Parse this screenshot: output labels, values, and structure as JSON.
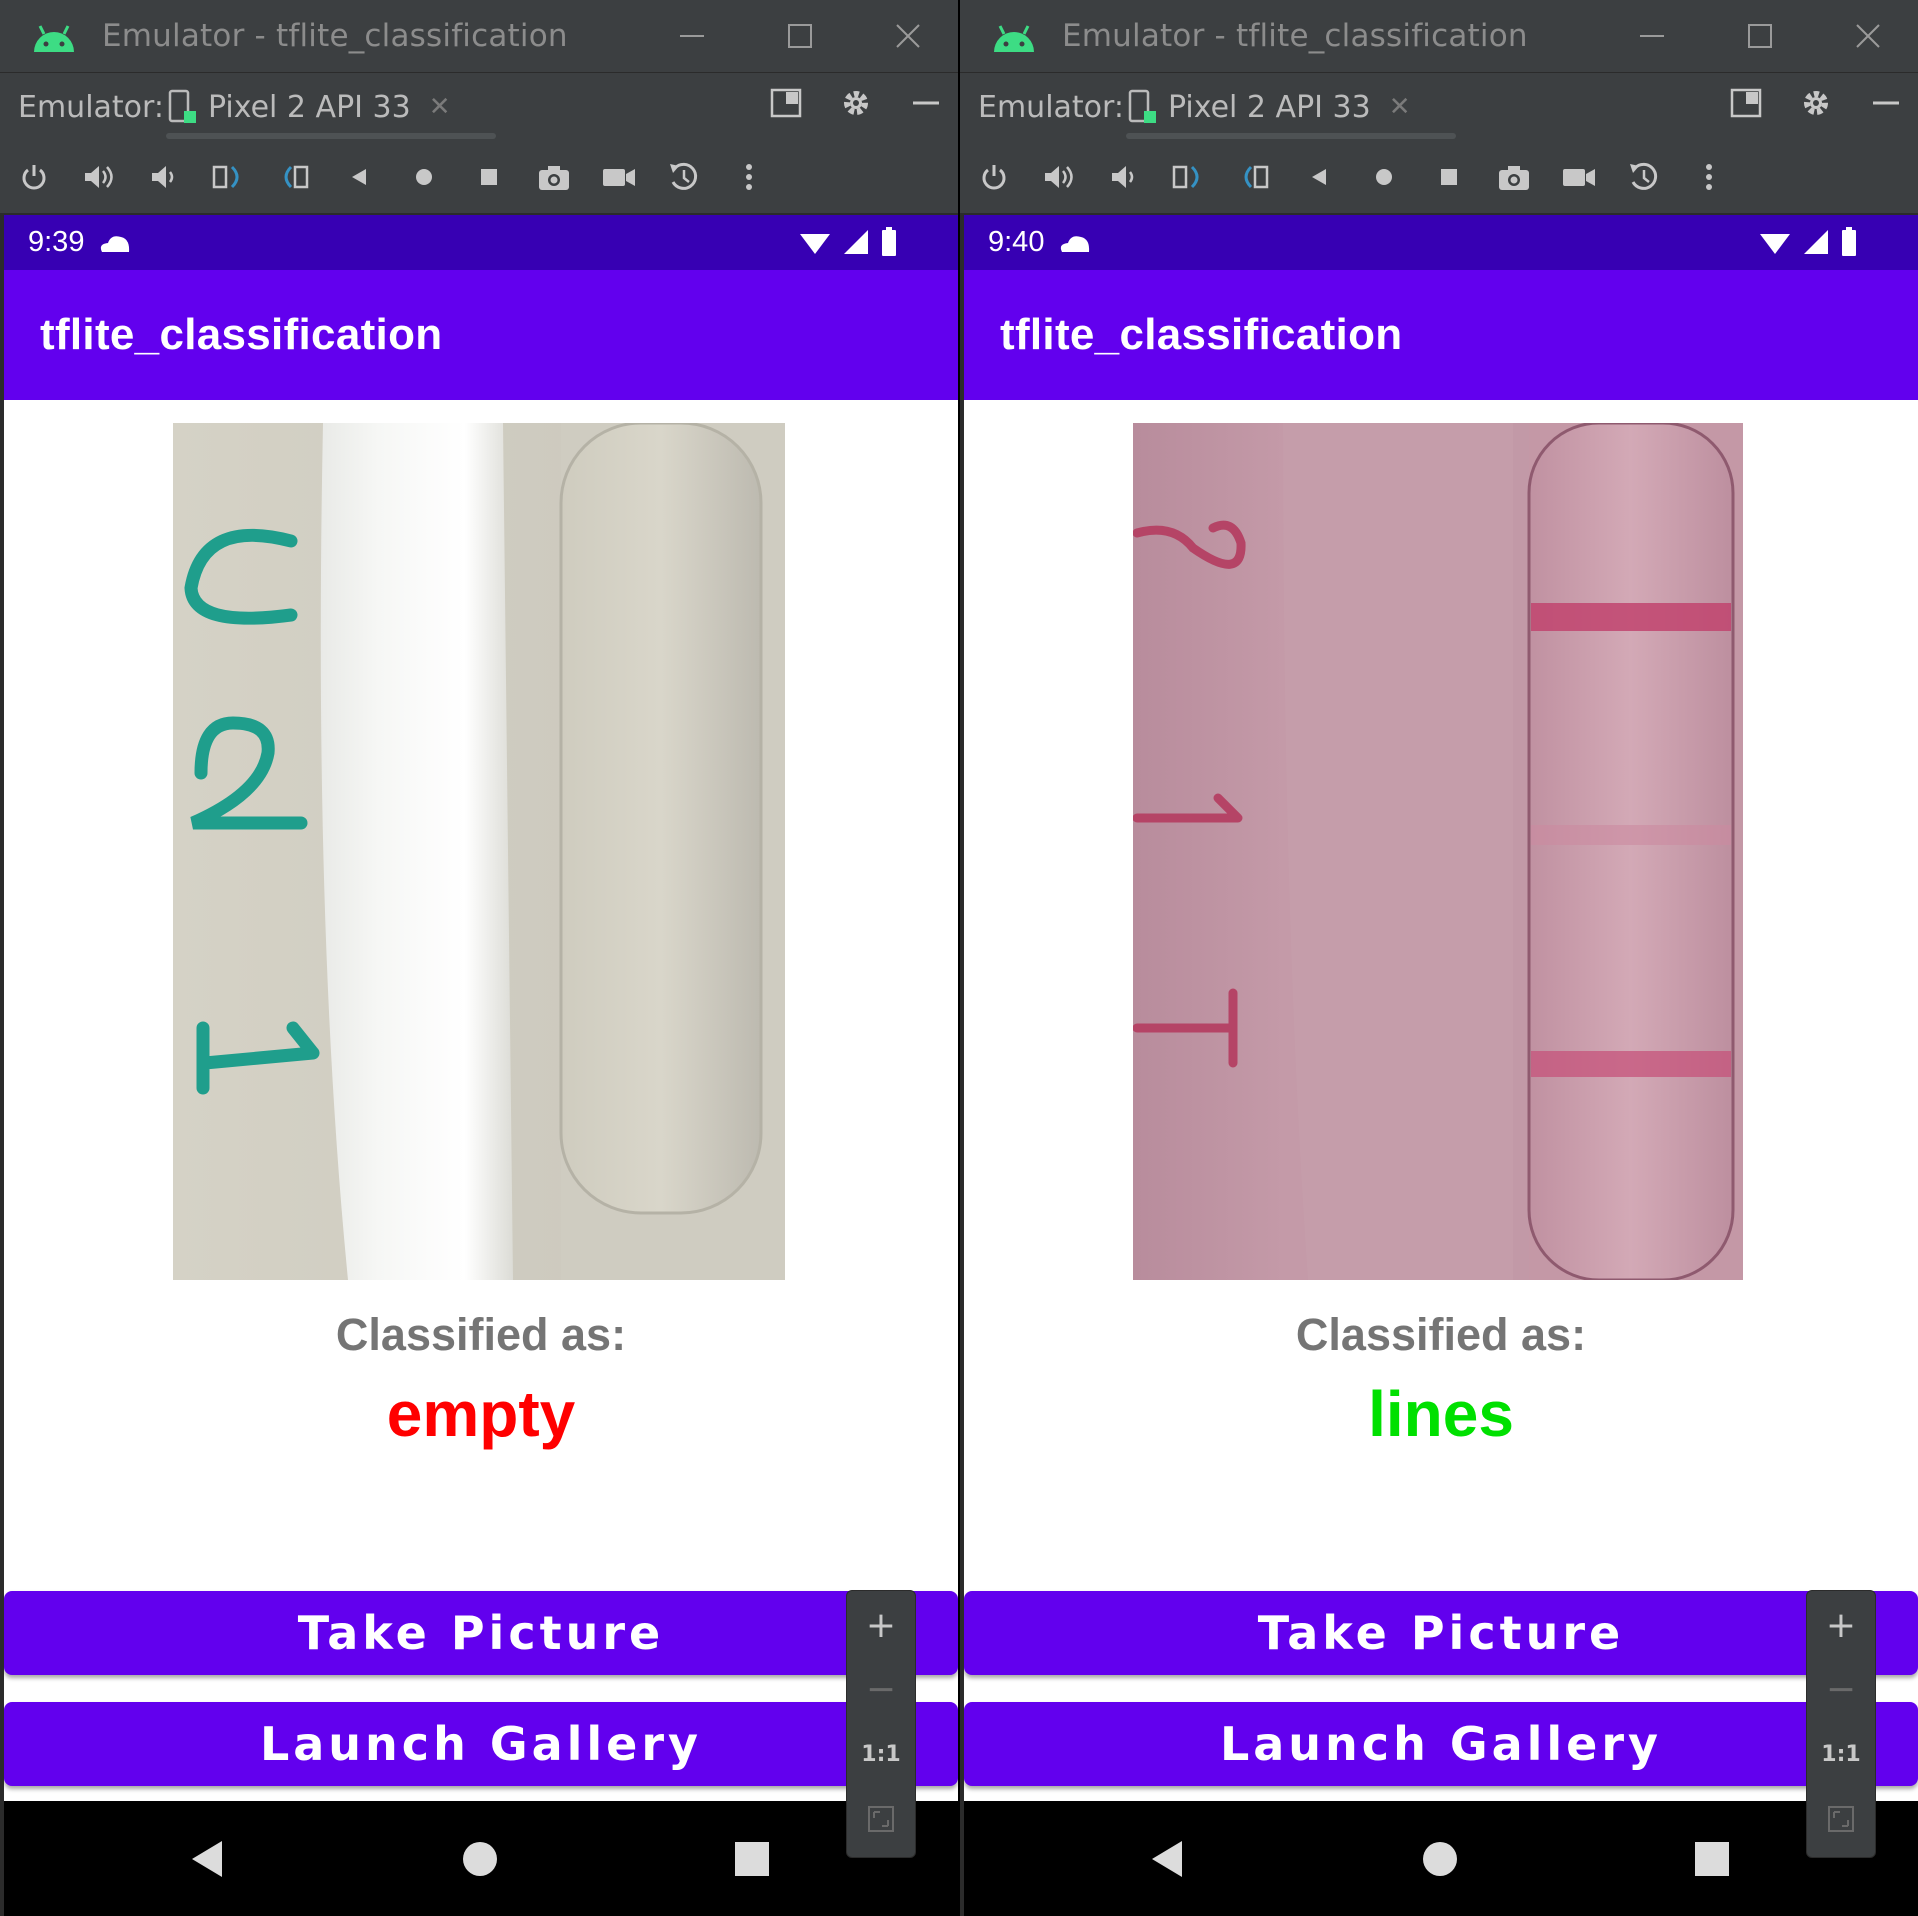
{
  "panes": [
    {
      "window_title": "Emulator - tflite_classification",
      "tab_label": "Emulator:",
      "device_name": "Pixel 2 API 33",
      "status_time": "9:39",
      "app_title": "tflite_classification",
      "classified_label": "Classified as:",
      "result": "empty",
      "result_color": "#ff0000",
      "buttons": {
        "take_picture": "Take Picture",
        "launch_gallery": "Launch Gallery"
      },
      "zoom": {
        "plus": "+",
        "minus": "−",
        "ratio": "1:1"
      },
      "image_numerals": [
        "C",
        "2",
        "1"
      ]
    },
    {
      "window_title": "Emulator - tflite_classification",
      "tab_label": "Emulator:",
      "device_name": "Pixel 2 API 33",
      "status_time": "9:40",
      "app_title": "tflite_classification",
      "classified_label": "Classified as:",
      "result": "lines",
      "result_color": "#00e000",
      "buttons": {
        "take_picture": "Take Picture",
        "launch_gallery": "Launch Gallery"
      },
      "zoom": {
        "plus": "+",
        "minus": "−",
        "ratio": "1:1"
      },
      "image_numerals": [
        "2",
        "1",
        "T"
      ]
    }
  ],
  "colors": {
    "status_bar": "#3700b3",
    "app_bar": "#6200ee",
    "button": "#6200ee",
    "ide_chrome": "#3c3f41"
  },
  "icons": {
    "title_bar": [
      "android-logo-icon",
      "minimize-icon",
      "maximize-icon",
      "close-icon"
    ],
    "tab_bar": [
      "device-icon",
      "tab-close-icon",
      "window-mode-icon",
      "settings-gear-icon",
      "hide-panel-icon"
    ],
    "toolbar": [
      "power-icon",
      "volume-up-icon",
      "volume-down-icon",
      "rotate-left-icon",
      "rotate-right-icon",
      "back-icon",
      "home-icon",
      "overview-icon",
      "screenshot-camera-icon",
      "screen-record-icon",
      "snapshot-icon",
      "more-options-icon"
    ],
    "status_bar": [
      "cloud-icon",
      "wifi-icon",
      "cell-signal-icon",
      "battery-icon"
    ],
    "nav_bar": [
      "nav-back-icon",
      "nav-home-icon",
      "nav-recents-icon"
    ]
  }
}
